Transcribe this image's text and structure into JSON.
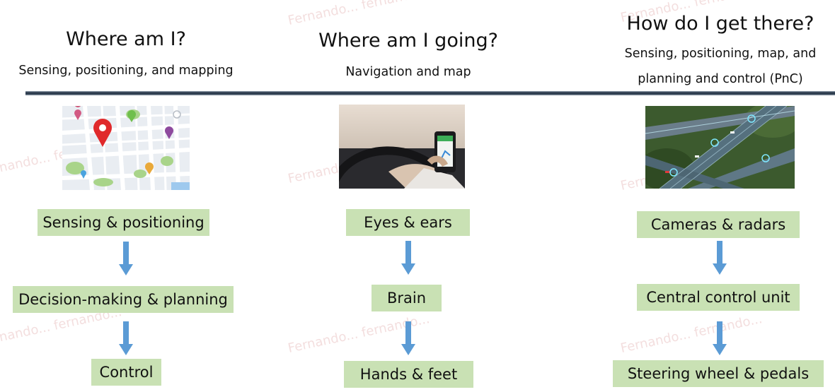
{
  "columns": [
    {
      "title": "Where am I?",
      "subtitle_lines": [
        "Sensing, positioning, and mapping"
      ],
      "image": "city-map-pins",
      "boxes": [
        "Sensing & positioning",
        "Decision-making & planning",
        "Control"
      ]
    },
    {
      "title": "Where am I going?",
      "subtitle_lines": [
        "Navigation and map"
      ],
      "image": "driver-phone-navigation",
      "boxes": [
        "Eyes & ears",
        "Brain",
        "Hands & feet"
      ]
    },
    {
      "title": "How do I get there?",
      "subtitle_lines": [
        "Sensing, positioning, map, and",
        "planning and control (PnC)"
      ],
      "image": "highway-interchange-aerial",
      "boxes": [
        "Cameras & radars",
        "Central control unit",
        "Steering wheel & pedals"
      ]
    }
  ],
  "watermark": "Fernando... fernando...",
  "colors": {
    "box_fill": "#c9e1b4",
    "arrow": "#5b9bd5",
    "divider": "#2b3a4c"
  }
}
